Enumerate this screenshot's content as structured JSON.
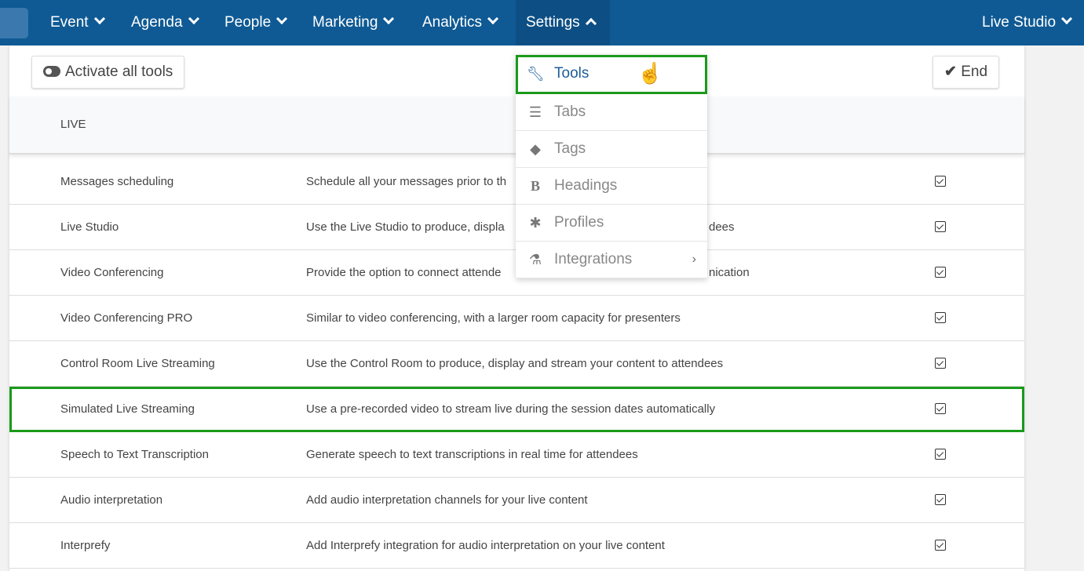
{
  "nav": {
    "items": [
      "Event",
      "Agenda",
      "People",
      "Marketing",
      "Analytics",
      "Settings"
    ],
    "active": "Settings",
    "right": "Live Studio",
    "bar_color": "#0f5a94"
  },
  "toolbar": {
    "activate_all": "Activate all tools",
    "end": "End"
  },
  "table": {
    "section_header": "LIVE",
    "rows": [
      {
        "name": "Messages scheduling",
        "desc": "Schedule all your messages prior to th",
        "desc_tail": "",
        "checked": true
      },
      {
        "name": "Live Studio",
        "desc": "Use the Live Studio to produce, displa",
        "desc_tail": "dees",
        "checked": true
      },
      {
        "name": "Video Conferencing",
        "desc": "Provide the option to connect attende",
        "desc_tail": "nication",
        "checked": true
      },
      {
        "name": "Video Conferencing PRO",
        "desc": "Similar to video conferencing, with a larger room capacity for presenters",
        "desc_tail": "",
        "checked": true
      },
      {
        "name": "Control Room Live Streaming",
        "desc": "Use the Control Room to produce, display and stream your content to attendees",
        "desc_tail": "",
        "checked": true
      },
      {
        "name": "Simulated Live Streaming",
        "desc": "Use a pre-recorded video to stream live during the session dates automatically",
        "desc_tail": "",
        "checked": true,
        "highlighted": true
      },
      {
        "name": "Speech to Text Transcription",
        "desc": "Generate speech to text transcriptions in real time for attendees",
        "desc_tail": "",
        "checked": true
      },
      {
        "name": "Audio interpretation",
        "desc": "Add audio interpretation channels for your live content",
        "desc_tail": "",
        "checked": true
      },
      {
        "name": "Interprefy",
        "desc": "Add Interprefy integration for audio interpretation on your live content",
        "desc_tail": "",
        "checked": true
      }
    ]
  },
  "settings_menu": {
    "items": [
      {
        "label": "Tools",
        "icon": "wrench-icon",
        "selected": true
      },
      {
        "label": "Tabs",
        "icon": "list-check-icon"
      },
      {
        "label": "Tags",
        "icon": "tags-icon"
      },
      {
        "label": "Headings",
        "icon": "bold-icon"
      },
      {
        "label": "Profiles",
        "icon": "asterisk-icon"
      },
      {
        "label": "Integrations",
        "icon": "flask-icon",
        "submenu": true
      }
    ]
  },
  "highlight_color": "#1a9a1a"
}
